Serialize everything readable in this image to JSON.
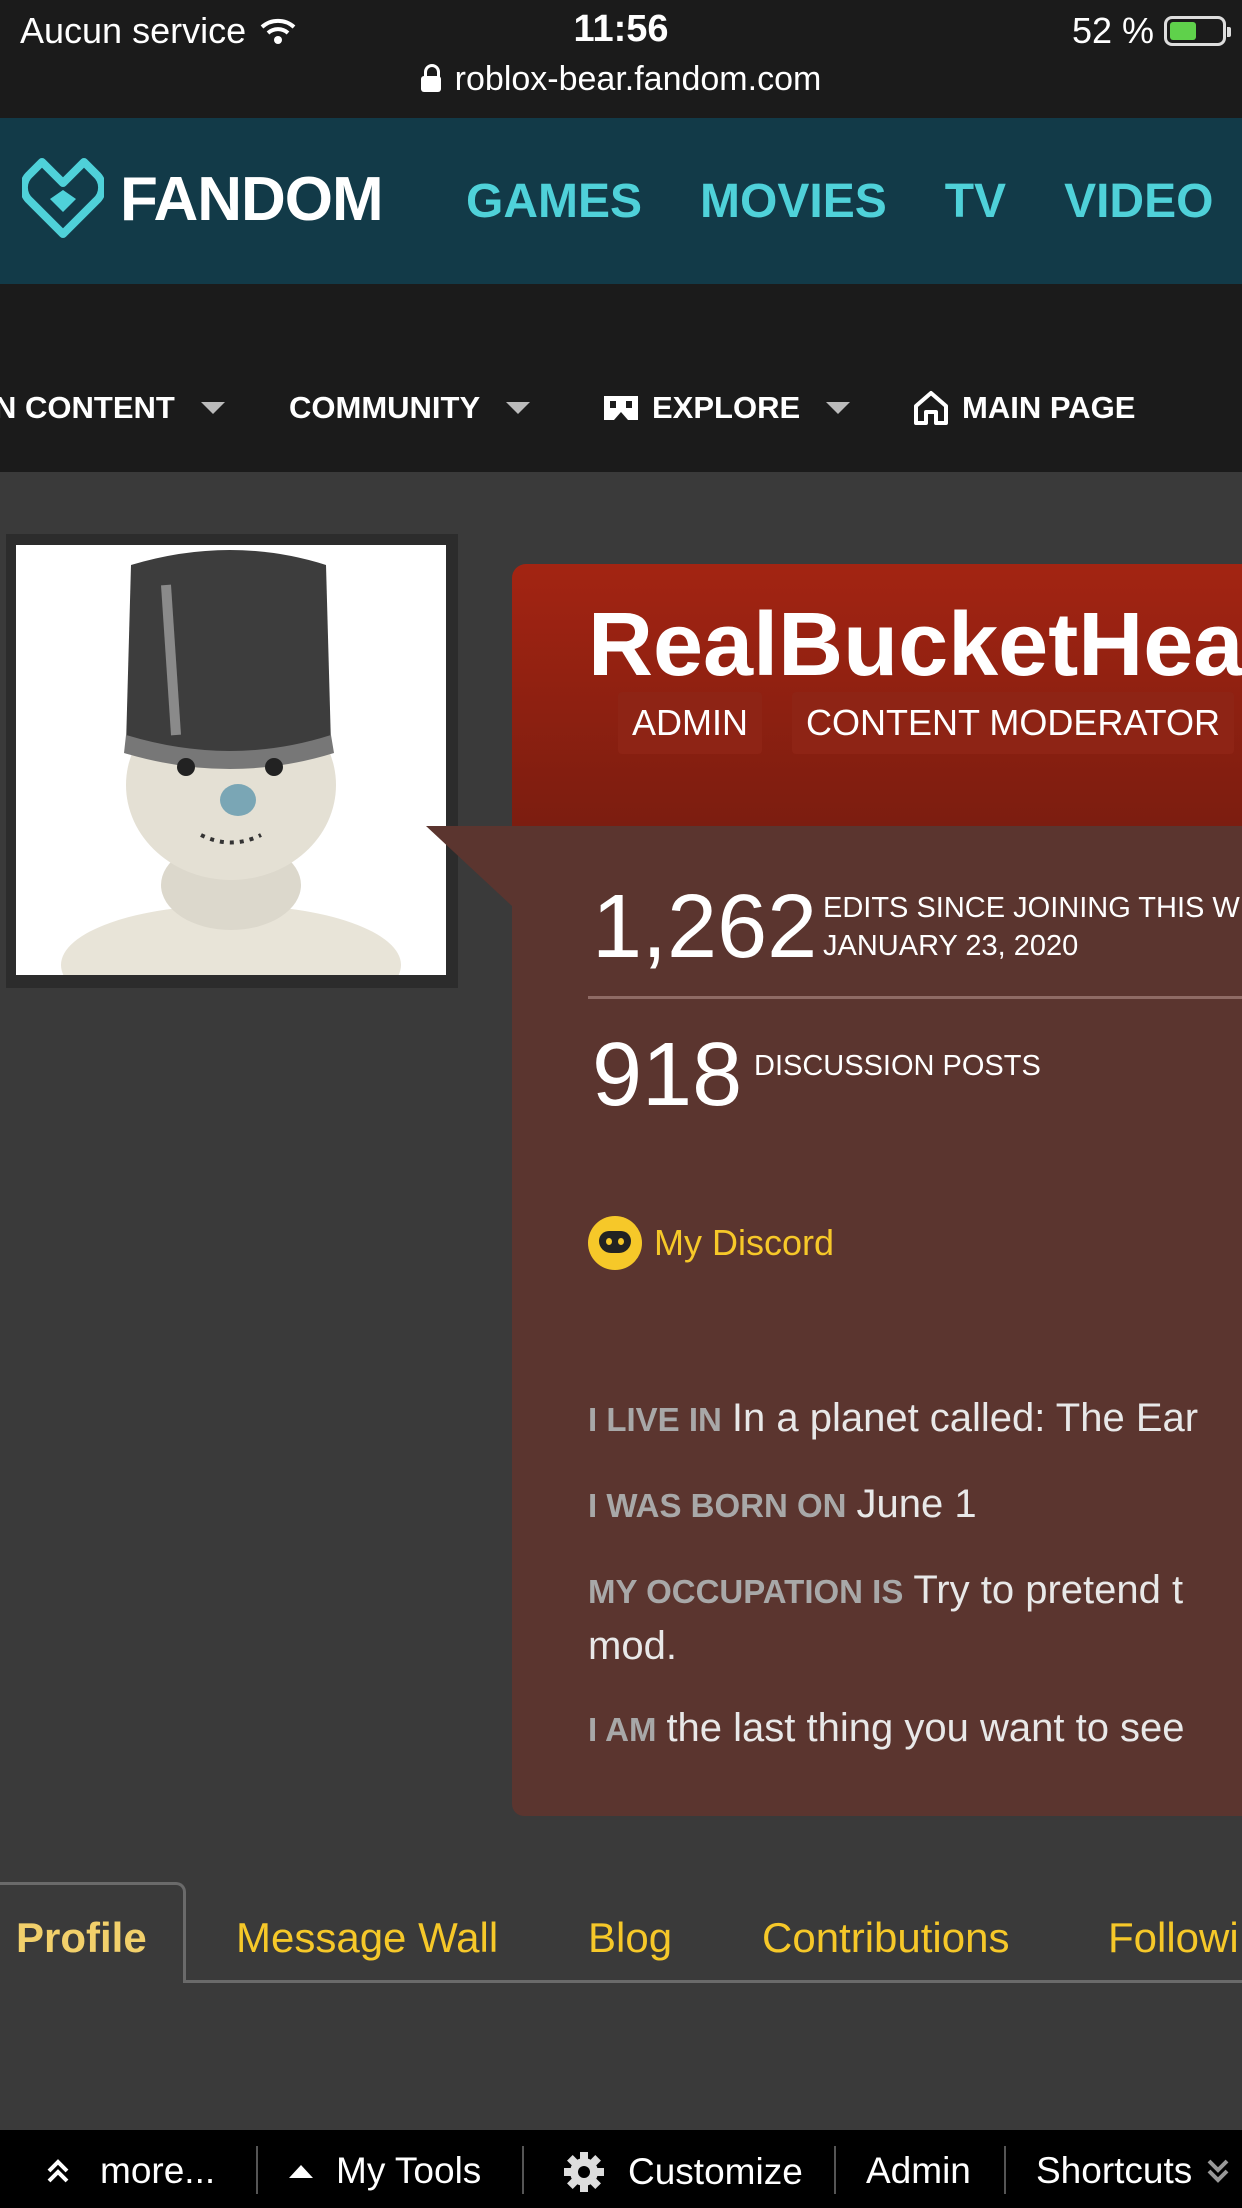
{
  "status": {
    "carrier": "Aucun service",
    "time": "11:56",
    "battery": "52 %",
    "battery_level": 0.52,
    "url": "roblox-bear.fandom.com"
  },
  "header": {
    "logo": "FANDOM",
    "nav": [
      "GAMES",
      "MOVIES",
      "TV",
      "VIDEO"
    ]
  },
  "wiki_nav": {
    "items": [
      "N CONTENT",
      "COMMUNITY",
      "EXPLORE",
      "MAIN PAGE"
    ]
  },
  "profile": {
    "username": "RealBucketHea",
    "badges": [
      "ADMIN",
      "CONTENT MODERATOR"
    ],
    "edits_count": "1,262",
    "edits_label_1": "EDITS SINCE JOINING THIS W",
    "edits_label_2": "JANUARY 23, 2020",
    "posts_count": "918",
    "posts_label": "DISCUSSION POSTS",
    "discord": "My Discord",
    "live_label": "I LIVE IN",
    "live_value": "In a planet called: The Ear",
    "born_label": "I WAS BORN ON",
    "born_value": "June 1",
    "occupation_label": "MY OCCUPATION IS",
    "occupation_value": "Try to pretend t",
    "occupation_value_2": "mod.",
    "am_label": "I AM",
    "am_value": "the last thing you want to see"
  },
  "tabs": [
    "Profile",
    "Message Wall",
    "Blog",
    "Contributions",
    "Followi"
  ],
  "toolbar": [
    "more...",
    "My Tools",
    "Customize",
    "Admin",
    "Shortcuts"
  ],
  "colors": {
    "accent": "#f6c829",
    "fandom_teal": "#4fd1d9",
    "header_red": "#a32412",
    "card_brown": "#5b352f"
  }
}
